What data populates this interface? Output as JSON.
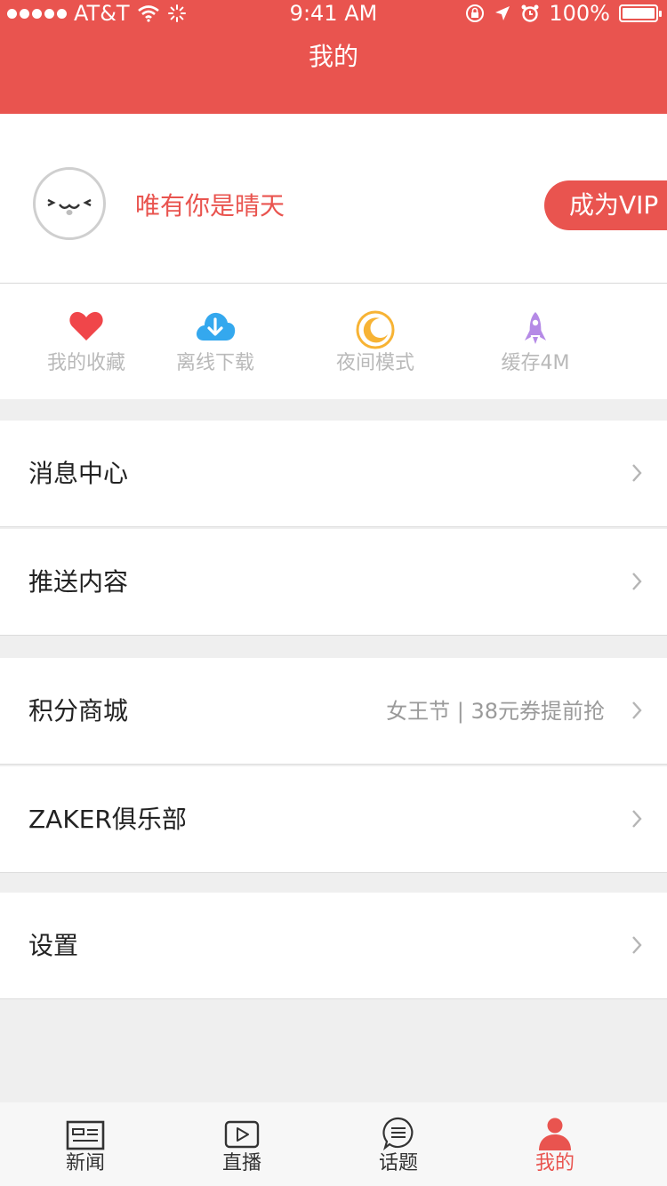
{
  "status_bar": {
    "carrier": "AT&T",
    "time": "9:41 AM",
    "battery": "100%"
  },
  "header": {
    "title": "我的"
  },
  "profile": {
    "username": "唯有你是晴天",
    "vip_button": "成为VIP"
  },
  "quick_actions": [
    {
      "label": "我的收藏",
      "icon": "heart-icon",
      "color": "#f0464a"
    },
    {
      "label": "离线下载",
      "icon": "cloud-download-icon",
      "color": "#34a8ee"
    },
    {
      "label": "夜间模式",
      "icon": "moon-icon",
      "color": "#f7b334"
    },
    {
      "label": "缓存4M",
      "icon": "rocket-icon",
      "color": "#b58ae6"
    }
  ],
  "menu": {
    "messages": "消息中心",
    "push": "推送内容",
    "points_mall": "积分商城",
    "points_mall_promo": "女王节 | 38元券提前抢",
    "club": "ZAKER俱乐部",
    "settings": "设置"
  },
  "tabs": [
    {
      "label": "新闻",
      "icon": "news-icon"
    },
    {
      "label": "直播",
      "icon": "live-icon"
    },
    {
      "label": "话题",
      "icon": "topic-icon"
    },
    {
      "label": "我的",
      "icon": "profile-icon",
      "active": true
    }
  ],
  "colors": {
    "accent": "#e9544f",
    "background": "#efefef"
  }
}
